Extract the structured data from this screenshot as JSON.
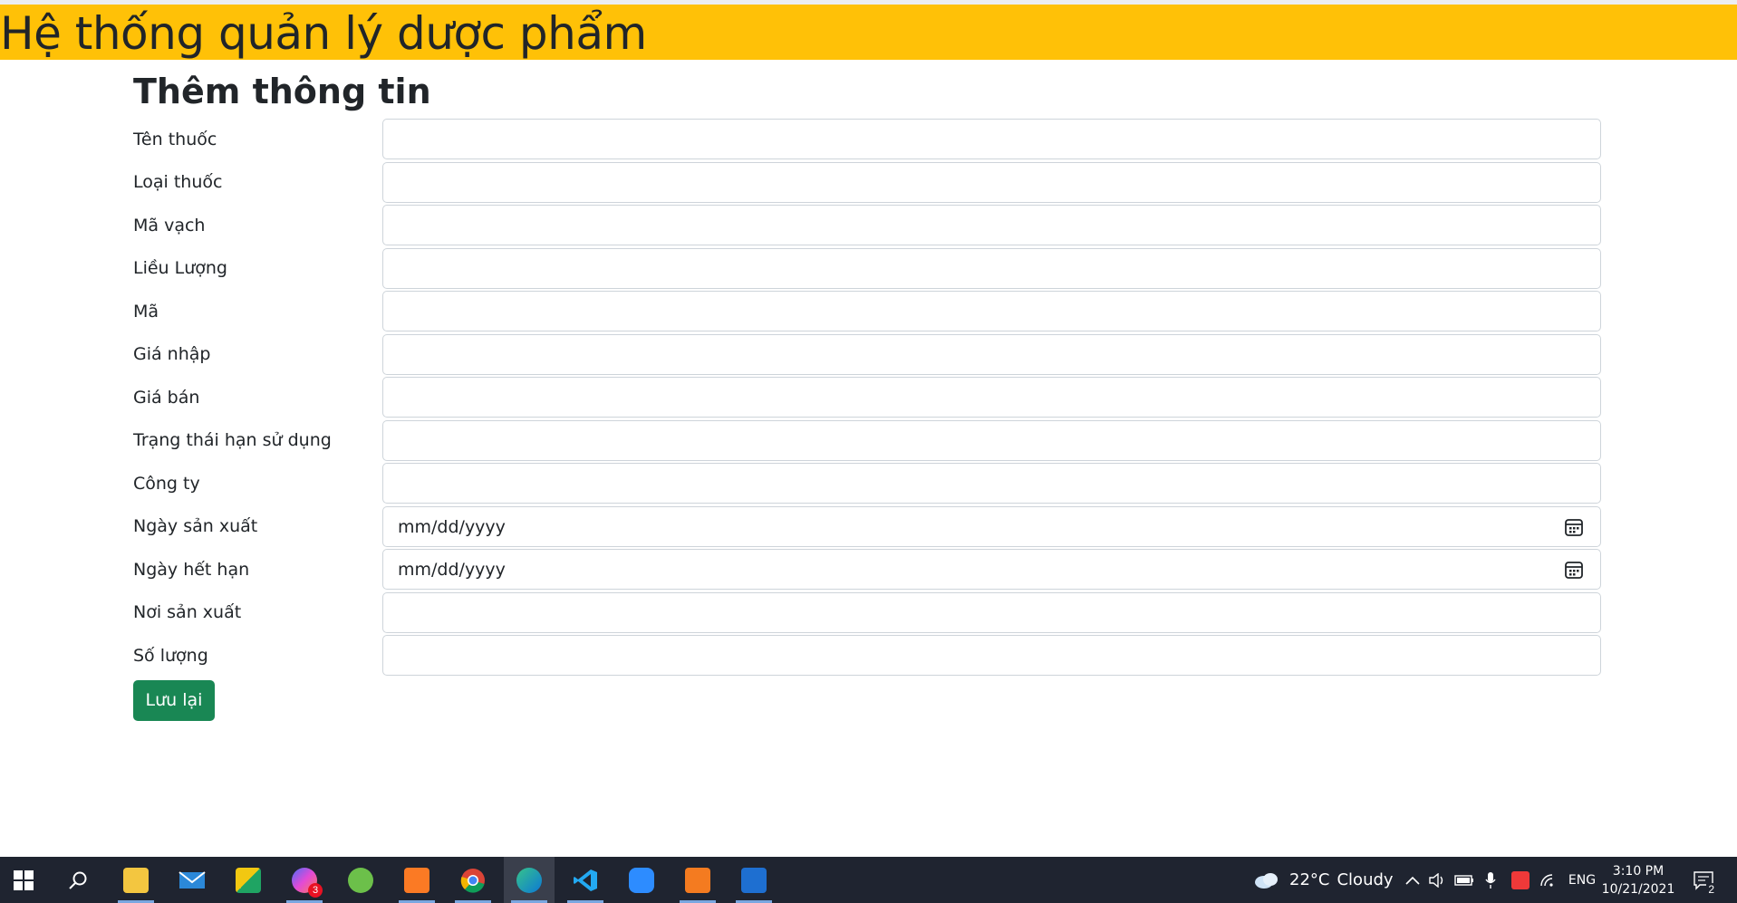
{
  "header": {
    "title": "Hệ thống quản lý dược phẩm"
  },
  "form": {
    "title": "Thêm thông tin",
    "fields": [
      {
        "label": "Tên thuốc",
        "type": "text",
        "value": ""
      },
      {
        "label": "Loại thuốc",
        "type": "text",
        "value": ""
      },
      {
        "label": "Mã vạch",
        "type": "text",
        "value": ""
      },
      {
        "label": "Liều Lượng",
        "type": "text",
        "value": ""
      },
      {
        "label": "Mã",
        "type": "text",
        "value": ""
      },
      {
        "label": "Giá nhập",
        "type": "text",
        "value": ""
      },
      {
        "label": "Giá bán",
        "type": "text",
        "value": ""
      },
      {
        "label": "Trạng thái hạn sử dụng",
        "type": "text",
        "value": ""
      },
      {
        "label": "Công ty",
        "type": "text",
        "value": ""
      },
      {
        "label": "Ngày sản xuất",
        "type": "date",
        "placeholder": "mm/dd/yyyy"
      },
      {
        "label": "Ngày hết hạn",
        "type": "date",
        "placeholder": "mm/dd/yyyy"
      },
      {
        "label": "Nơi sản xuất",
        "type": "text",
        "value": ""
      },
      {
        "label": "Số lượng",
        "type": "text",
        "value": ""
      }
    ],
    "submit_label": "Lưu lại"
  },
  "taskbar": {
    "apps": [
      {
        "icon": "windows-start-icon"
      },
      {
        "icon": "search-icon"
      },
      {
        "icon": "file-explorer-icon"
      },
      {
        "icon": "mail-icon"
      },
      {
        "icon": "snip-sketch-icon"
      },
      {
        "icon": "messenger-icon",
        "badge": "3"
      },
      {
        "icon": "green-app-icon"
      },
      {
        "icon": "xampp-icon"
      },
      {
        "icon": "chrome-icon"
      },
      {
        "icon": "edge-icon"
      },
      {
        "icon": "vscode-icon"
      },
      {
        "icon": "zoom-icon"
      },
      {
        "icon": "orange-app-icon"
      },
      {
        "icon": "media-player-icon"
      }
    ],
    "weather": {
      "temp": "22°C",
      "condition": "Cloudy"
    },
    "language": "ENG",
    "time": "3:10 PM",
    "date": "10/21/2021",
    "notifications": "2",
    "colors": {
      "background": "#1f2430",
      "accent": "#7aa7e0"
    }
  },
  "colors": {
    "header": "#ffc107",
    "save_button": "#198754"
  }
}
